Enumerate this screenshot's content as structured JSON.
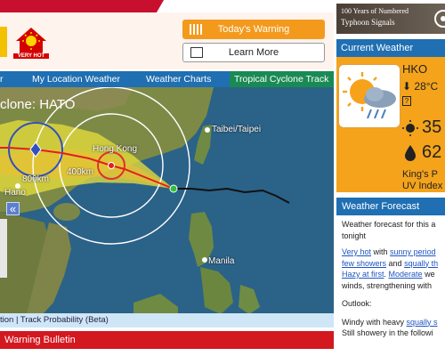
{
  "header": {
    "signal_icons": [
      "cyclone-signal-icon",
      "very-hot-icon"
    ],
    "very_hot_label": "VERY HOT",
    "todays_warning_label": "Today's Warning",
    "learn_more_label": "Learn More",
    "banner_line1": "100 Years of Numbered",
    "banner_line2": "Typhoon Signals"
  },
  "nav": {
    "items": [
      {
        "label": "r"
      },
      {
        "label": "My Location Weather"
      },
      {
        "label": "Weather Charts"
      },
      {
        "label": "Tropical Cyclone Track"
      }
    ]
  },
  "map": {
    "title": "clone:  HATO",
    "labels": {
      "hong_kong": "Hong Kong",
      "taipei": "Taibei/Taipei",
      "manila": "Manila",
      "hanoi": "Hano",
      "r400": "400km",
      "r800": "800km"
    },
    "collapse_symbol": "«",
    "probability_text": "tion | Track Probability (Beta)"
  },
  "warning_bulletin": {
    "label": "Warning Bulletin"
  },
  "current_weather": {
    "title": "Current Weather",
    "station": "HKO",
    "temperature": "28°C",
    "uv_value": "35",
    "humidity_value": "62",
    "station2": "King's P",
    "uv_index_label": "UV Index"
  },
  "forecast": {
    "title": "Weather Forecast",
    "intro": "Weather forecast for this a",
    "intro2": "tonight",
    "line1a": "Very hot",
    "line1b": " with ",
    "line1c": "sunny period",
    "line2a": "few showers",
    "line2b": " and ",
    "line2c": "squally th",
    "line3a": "Hazy at first",
    "line3b": ". ",
    "line3c": "Moderate",
    "line3d": " we",
    "line4": "winds, strengthening with",
    "outlook_label": "Outlook:",
    "outlook1a": "Windy with heavy ",
    "outlook1b": "squally s",
    "outlook2": "Still showery in the followi"
  },
  "colors": {
    "nav_blue": "#1f6fb2",
    "active_tab_green": "#1a8a55",
    "warning_orange": "#f39a1d",
    "bulletin_red": "#d41820",
    "current_weather_orange": "#f4a31b"
  }
}
